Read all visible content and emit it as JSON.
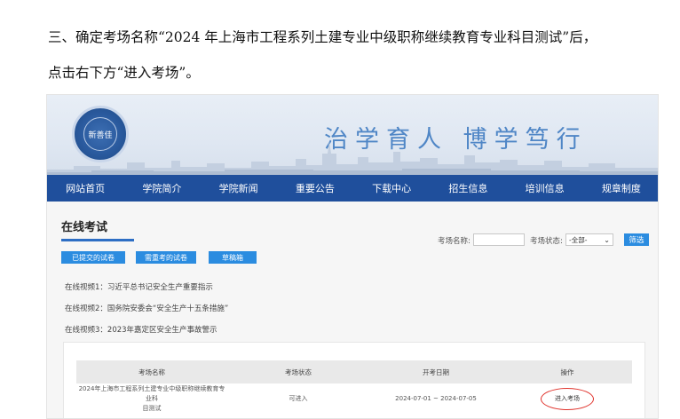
{
  "instruction": {
    "line1": "三、确定考场名称“2024 年上海市工程系列土建专业中级职称继续教育专业科目测试”后，",
    "line2": "点击右下方“进入考场”。"
  },
  "site": {
    "logo_text": "新善佳",
    "slogan": "治学育人 博学笃行",
    "nav": [
      "网站首页",
      "学院简介",
      "学院新闻",
      "重要公告",
      "下载中心",
      "招生信息",
      "培训信息",
      "规章制度"
    ]
  },
  "exam": {
    "section_title": "在线考试",
    "filter": {
      "name_label": "考场名称:",
      "name_value": "",
      "status_label": "考场状态:",
      "status_value": "-全部-",
      "button": "筛选"
    },
    "tabs": [
      "已提交的试卷",
      "需重考的试卷",
      "草稿箱"
    ],
    "videos": [
      "在线视频1：习近平总书记安全生产重要指示",
      "在线视频2：国务院安委会“安全生产十五条措施”",
      "在线视频3：2023年嘉定区安全生产事故警示"
    ],
    "table": {
      "headers": [
        "考场名称",
        "考场状态",
        "开考日期",
        "操作"
      ],
      "rows": [
        {
          "name_l1": "2024年上海市工程系列土建专业中级职称继续教育专业科",
          "name_l2": "目测试",
          "status": "可进入",
          "date": "2024-07-01 ~ 2024-07-05",
          "action": "进入考场"
        }
      ]
    }
  },
  "colors": {
    "nav_bg": "#1f4f9c",
    "button_bg": "#2b8ce0",
    "slogan": "#4f86c6",
    "highlight_ring": "#e0322b"
  }
}
